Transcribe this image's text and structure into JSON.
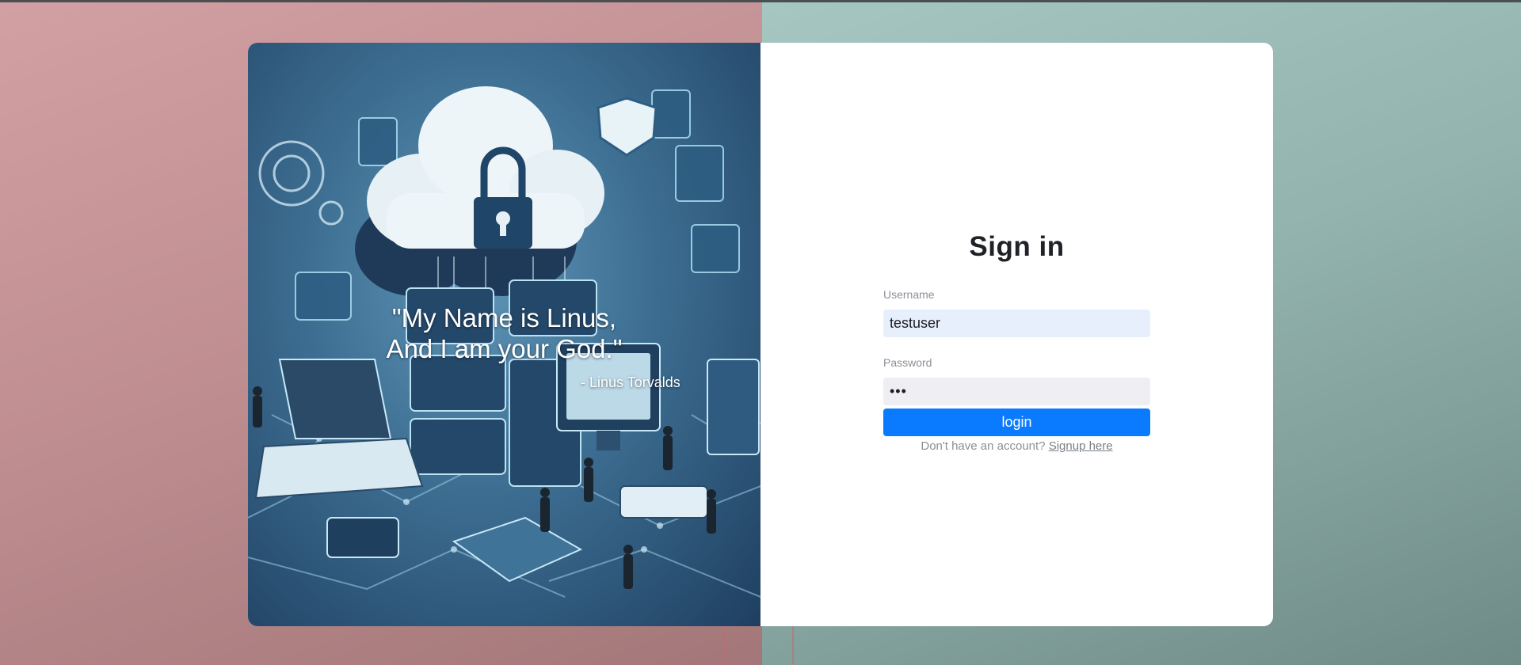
{
  "hero": {
    "quote_line_1": "\"My Name is Linus,",
    "quote_line_2": "And I am your God.\"",
    "quote_author": "- Linus Torvalds"
  },
  "form": {
    "title": "Sign in",
    "username_label": "Username",
    "username_value": "testuser",
    "password_label": "Password",
    "password_value": "•••",
    "login_label": "login",
    "signup_prompt": "Don't have an account?",
    "signup_link": "Signup here"
  },
  "colors": {
    "accent": "#0a7bff",
    "background_left": "#c9999c",
    "background_right": "#9bbcb8"
  }
}
